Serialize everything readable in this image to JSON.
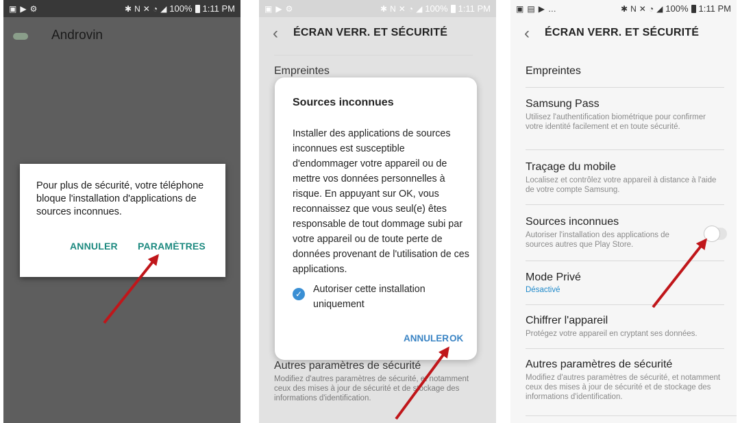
{
  "status": {
    "time": "1:11 PM",
    "battery": "100%"
  },
  "panel1": {
    "app_title": "Androvin",
    "dialog": {
      "message": "Pour plus de sécurité, votre téléphone bloque l'installation d'applications de sources inconnues.",
      "cancel": "ANNULER",
      "settings": "PARAMÈTRES"
    }
  },
  "panel2": {
    "header": "ÉCRAN VERR. ET SÉCURITÉ",
    "bg_items": {
      "fingerprints": "Empreintes",
      "other_title": "Autres paramètres de sécurité",
      "other_sub": "Modifiez d'autres paramètres de sécurité, et notamment ceux des mises à jour de sécurité et de stockage des informations d'identification."
    },
    "dialog": {
      "title": "Sources inconnues",
      "message": "Installer des applications de sources inconnues est susceptible d'endommager votre appareil ou de mettre vos données personnelles à risque. En appuyant sur OK, vous reconnaissez que vous seul(e) êtes responsable de tout dommage subi par votre appareil ou de toute perte de données provenant de l'utilisation de ces applications.",
      "checkbox_label": "Autoriser cette installation uniquement",
      "cancel": "ANNULER",
      "ok": "OK"
    }
  },
  "panel3": {
    "header": "ÉCRAN VERR. ET SÉCURITÉ",
    "items": [
      {
        "title": "Empreintes",
        "sub": ""
      },
      {
        "title": "Samsung Pass",
        "sub": "Utilisez l'authentification biométrique pour confirmer votre identité facilement et en toute sécurité."
      },
      {
        "title": "Traçage du mobile",
        "sub": "Localisez et contrôlez votre appareil à distance à l'aide de votre compte Samsung."
      },
      {
        "title": "Sources inconnues",
        "sub": "Autoriser l'installation des applications de sources autres que Play Store."
      },
      {
        "title": "Mode Privé",
        "value": "Désactivé"
      },
      {
        "title": "Chiffrer l'appareil",
        "sub": "Protégez votre appareil en cryptant ses données."
      },
      {
        "title": "Autres paramètres de sécurité",
        "sub": "Modifiez d'autres paramètres de sécurité, et notamment ceux des mises à jour de sécurité et de stockage des informations d'identification."
      }
    ],
    "unknown_sources_enabled": false
  },
  "colors": {
    "accent_teal": "#1d8a80",
    "accent_blue": "#3a84c4",
    "arrow": "#c0161a"
  }
}
